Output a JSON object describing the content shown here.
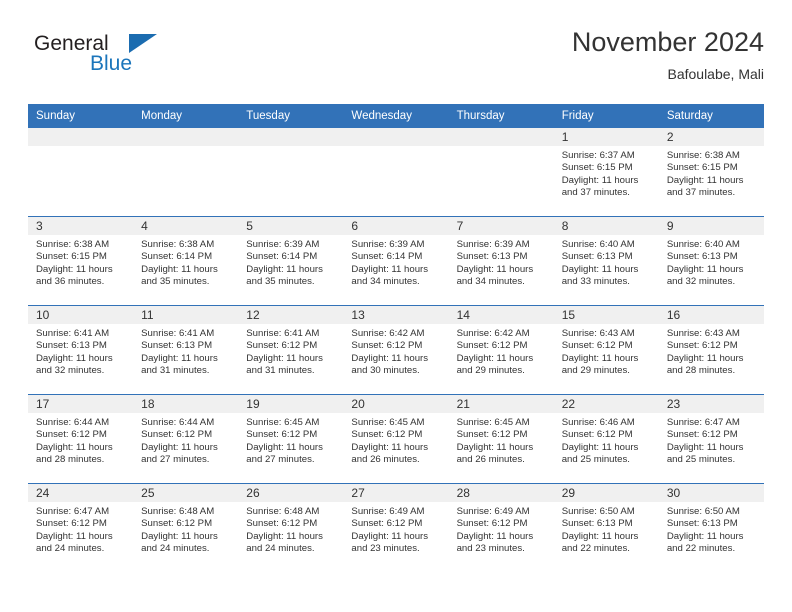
{
  "brand": {
    "word1": "General",
    "word2": "Blue",
    "triangle_color": "#1b6cb0",
    "blue_color": "#1b75bb"
  },
  "header": {
    "title": "November 2024",
    "location": "Bafoulabe, Mali"
  },
  "theme": {
    "header_bg": "#3272b8",
    "daynum_bg": "#f0f0f0",
    "text": "#333333"
  },
  "labels": {
    "sunrise_prefix": "Sunrise:",
    "sunset_prefix": "Sunset:",
    "daylight_prefix": "Daylight:"
  },
  "weekdays": [
    "Sunday",
    "Monday",
    "Tuesday",
    "Wednesday",
    "Thursday",
    "Friday",
    "Saturday"
  ],
  "weeks": [
    [
      {
        "day": "",
        "blank": true
      },
      {
        "day": "",
        "blank": true
      },
      {
        "day": "",
        "blank": true
      },
      {
        "day": "",
        "blank": true
      },
      {
        "day": "",
        "blank": true
      },
      {
        "day": "1",
        "sunrise": "Sunrise: 6:37 AM",
        "sunset": "Sunset: 6:15 PM",
        "daylight": "Daylight: 11 hours and 37 minutes."
      },
      {
        "day": "2",
        "sunrise": "Sunrise: 6:38 AM",
        "sunset": "Sunset: 6:15 PM",
        "daylight": "Daylight: 11 hours and 37 minutes."
      }
    ],
    [
      {
        "day": "3",
        "sunrise": "Sunrise: 6:38 AM",
        "sunset": "Sunset: 6:15 PM",
        "daylight": "Daylight: 11 hours and 36 minutes."
      },
      {
        "day": "4",
        "sunrise": "Sunrise: 6:38 AM",
        "sunset": "Sunset: 6:14 PM",
        "daylight": "Daylight: 11 hours and 35 minutes."
      },
      {
        "day": "5",
        "sunrise": "Sunrise: 6:39 AM",
        "sunset": "Sunset: 6:14 PM",
        "daylight": "Daylight: 11 hours and 35 minutes."
      },
      {
        "day": "6",
        "sunrise": "Sunrise: 6:39 AM",
        "sunset": "Sunset: 6:14 PM",
        "daylight": "Daylight: 11 hours and 34 minutes."
      },
      {
        "day": "7",
        "sunrise": "Sunrise: 6:39 AM",
        "sunset": "Sunset: 6:13 PM",
        "daylight": "Daylight: 11 hours and 34 minutes."
      },
      {
        "day": "8",
        "sunrise": "Sunrise: 6:40 AM",
        "sunset": "Sunset: 6:13 PM",
        "daylight": "Daylight: 11 hours and 33 minutes."
      },
      {
        "day": "9",
        "sunrise": "Sunrise: 6:40 AM",
        "sunset": "Sunset: 6:13 PM",
        "daylight": "Daylight: 11 hours and 32 minutes."
      }
    ],
    [
      {
        "day": "10",
        "sunrise": "Sunrise: 6:41 AM",
        "sunset": "Sunset: 6:13 PM",
        "daylight": "Daylight: 11 hours and 32 minutes."
      },
      {
        "day": "11",
        "sunrise": "Sunrise: 6:41 AM",
        "sunset": "Sunset: 6:13 PM",
        "daylight": "Daylight: 11 hours and 31 minutes."
      },
      {
        "day": "12",
        "sunrise": "Sunrise: 6:41 AM",
        "sunset": "Sunset: 6:12 PM",
        "daylight": "Daylight: 11 hours and 31 minutes."
      },
      {
        "day": "13",
        "sunrise": "Sunrise: 6:42 AM",
        "sunset": "Sunset: 6:12 PM",
        "daylight": "Daylight: 11 hours and 30 minutes."
      },
      {
        "day": "14",
        "sunrise": "Sunrise: 6:42 AM",
        "sunset": "Sunset: 6:12 PM",
        "daylight": "Daylight: 11 hours and 29 minutes."
      },
      {
        "day": "15",
        "sunrise": "Sunrise: 6:43 AM",
        "sunset": "Sunset: 6:12 PM",
        "daylight": "Daylight: 11 hours and 29 minutes."
      },
      {
        "day": "16",
        "sunrise": "Sunrise: 6:43 AM",
        "sunset": "Sunset: 6:12 PM",
        "daylight": "Daylight: 11 hours and 28 minutes."
      }
    ],
    [
      {
        "day": "17",
        "sunrise": "Sunrise: 6:44 AM",
        "sunset": "Sunset: 6:12 PM",
        "daylight": "Daylight: 11 hours and 28 minutes."
      },
      {
        "day": "18",
        "sunrise": "Sunrise: 6:44 AM",
        "sunset": "Sunset: 6:12 PM",
        "daylight": "Daylight: 11 hours and 27 minutes."
      },
      {
        "day": "19",
        "sunrise": "Sunrise: 6:45 AM",
        "sunset": "Sunset: 6:12 PM",
        "daylight": "Daylight: 11 hours and 27 minutes."
      },
      {
        "day": "20",
        "sunrise": "Sunrise: 6:45 AM",
        "sunset": "Sunset: 6:12 PM",
        "daylight": "Daylight: 11 hours and 26 minutes."
      },
      {
        "day": "21",
        "sunrise": "Sunrise: 6:45 AM",
        "sunset": "Sunset: 6:12 PM",
        "daylight": "Daylight: 11 hours and 26 minutes."
      },
      {
        "day": "22",
        "sunrise": "Sunrise: 6:46 AM",
        "sunset": "Sunset: 6:12 PM",
        "daylight": "Daylight: 11 hours and 25 minutes."
      },
      {
        "day": "23",
        "sunrise": "Sunrise: 6:47 AM",
        "sunset": "Sunset: 6:12 PM",
        "daylight": "Daylight: 11 hours and 25 minutes."
      }
    ],
    [
      {
        "day": "24",
        "sunrise": "Sunrise: 6:47 AM",
        "sunset": "Sunset: 6:12 PM",
        "daylight": "Daylight: 11 hours and 24 minutes."
      },
      {
        "day": "25",
        "sunrise": "Sunrise: 6:48 AM",
        "sunset": "Sunset: 6:12 PM",
        "daylight": "Daylight: 11 hours and 24 minutes."
      },
      {
        "day": "26",
        "sunrise": "Sunrise: 6:48 AM",
        "sunset": "Sunset: 6:12 PM",
        "daylight": "Daylight: 11 hours and 24 minutes."
      },
      {
        "day": "27",
        "sunrise": "Sunrise: 6:49 AM",
        "sunset": "Sunset: 6:12 PM",
        "daylight": "Daylight: 11 hours and 23 minutes."
      },
      {
        "day": "28",
        "sunrise": "Sunrise: 6:49 AM",
        "sunset": "Sunset: 6:12 PM",
        "daylight": "Daylight: 11 hours and 23 minutes."
      },
      {
        "day": "29",
        "sunrise": "Sunrise: 6:50 AM",
        "sunset": "Sunset: 6:13 PM",
        "daylight": "Daylight: 11 hours and 22 minutes."
      },
      {
        "day": "30",
        "sunrise": "Sunrise: 6:50 AM",
        "sunset": "Sunset: 6:13 PM",
        "daylight": "Daylight: 11 hours and 22 minutes."
      }
    ]
  ]
}
